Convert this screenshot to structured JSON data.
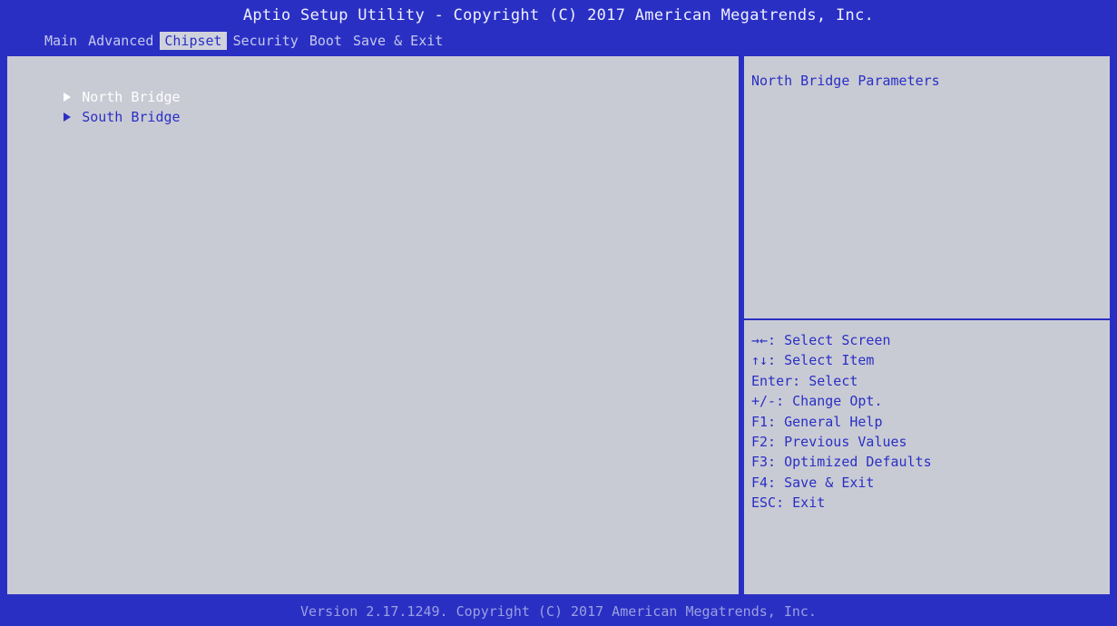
{
  "header": {
    "title": "Aptio Setup Utility - Copyright (C) 2017 American Megatrends, Inc.",
    "tabs": [
      {
        "label": "Main",
        "active": false
      },
      {
        "label": "Advanced",
        "active": false
      },
      {
        "label": "Chipset",
        "active": true
      },
      {
        "label": "Security",
        "active": false
      },
      {
        "label": "Boot",
        "active": false
      },
      {
        "label": "Save & Exit",
        "active": false
      }
    ]
  },
  "main": {
    "items": [
      {
        "label": "North Bridge",
        "selected": true
      },
      {
        "label": "South Bridge",
        "selected": false
      }
    ]
  },
  "help": {
    "description": "North Bridge Parameters",
    "keys": [
      "→←: Select Screen",
      "↑↓: Select Item",
      "Enter: Select",
      "+/-: Change Opt.",
      "F1: General Help",
      "F2: Previous Values",
      "F3: Optimized Defaults",
      "F4: Save & Exit",
      "ESC: Exit"
    ]
  },
  "footer": {
    "text": "Version 2.17.1249. Copyright (C) 2017 American Megatrends, Inc."
  },
  "colors": {
    "bios_blue": "#2a2fc4",
    "panel_gray": "#c9cbd4",
    "selected_text": "#ffffff"
  }
}
